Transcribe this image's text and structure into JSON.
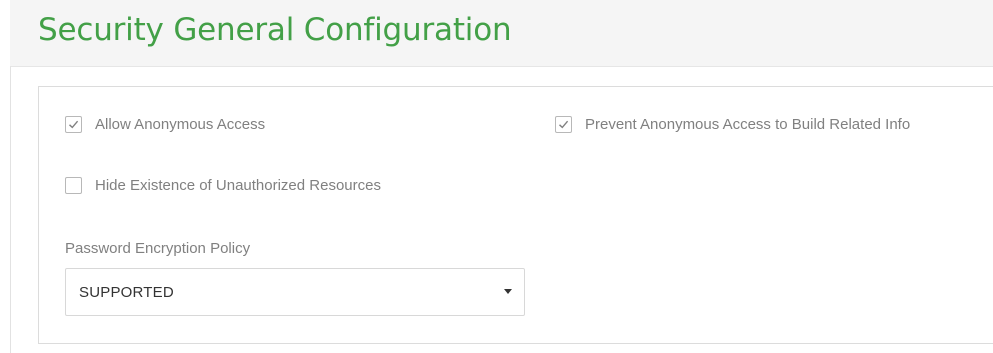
{
  "page": {
    "title": "Security General Configuration"
  },
  "settings": {
    "allow_anonymous_access": {
      "label": "Allow Anonymous Access",
      "checked": true
    },
    "prevent_anonymous_build_info": {
      "label": "Prevent Anonymous Access to Build Related Info",
      "checked": true
    },
    "hide_unauthorized_resources": {
      "label": "Hide Existence of Unauthorized Resources",
      "checked": false
    },
    "password_encryption_policy": {
      "label": "Password Encryption Policy",
      "value": "SUPPORTED"
    }
  },
  "icons": {
    "checkmark": "check-icon",
    "dropdown": "caret-down-icon"
  },
  "colors": {
    "title": "#43a047",
    "header_bg": "#f5f5f5",
    "label": "#808080",
    "border": "#dcdcdc"
  }
}
